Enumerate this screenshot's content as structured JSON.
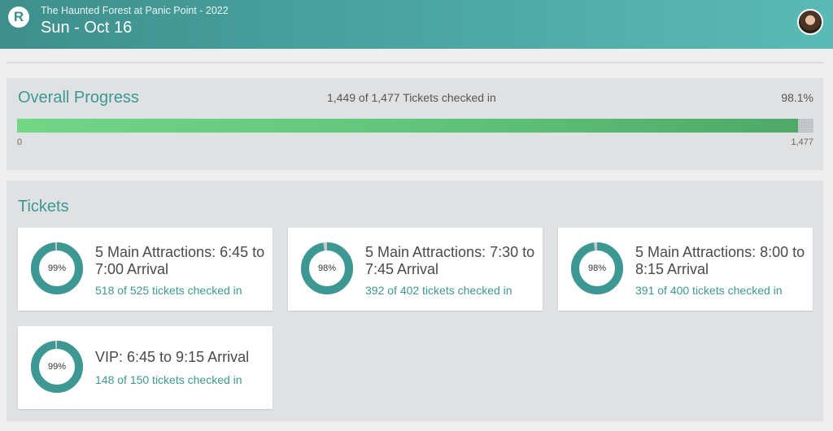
{
  "header": {
    "logo_letter": "R",
    "event_title": "The Haunted Forest at Panic Point - 2022",
    "date": "Sun - Oct 16",
    "avatar_icon": "user-avatar",
    "color": "#4aa39f"
  },
  "overall": {
    "title": "Overall Progress",
    "summary": "1,449 of 1,477 Tickets checked in",
    "percent_label": "98.1%",
    "progress_fraction": 0.981,
    "min_label": "0",
    "max_label": "1,477",
    "fill_color": "#5fc47a"
  },
  "tickets": {
    "title": "Tickets",
    "ring_color": "#3d9893",
    "ring_remainder_color": "#c8c8c8",
    "items": [
      {
        "percent_label": "99%",
        "fraction": 0.987,
        "name": "5 Main Attractions: 6:45 to 7:00 Arrival",
        "status": "518 of 525 tickets checked in"
      },
      {
        "percent_label": "98%",
        "fraction": 0.975,
        "name": "5 Main Attractions: 7:30 to 7:45 Arrival",
        "status": "392 of 402 tickets checked in"
      },
      {
        "percent_label": "98%",
        "fraction": 0.978,
        "name": "5 Main Attractions: 8:00 to 8:15 Arrival",
        "status": "391 of 400 tickets checked in"
      },
      {
        "percent_label": "99%",
        "fraction": 0.987,
        "name": "VIP: 6:45 to 9:15 Arrival",
        "status": "148 of 150 tickets checked in"
      }
    ]
  }
}
